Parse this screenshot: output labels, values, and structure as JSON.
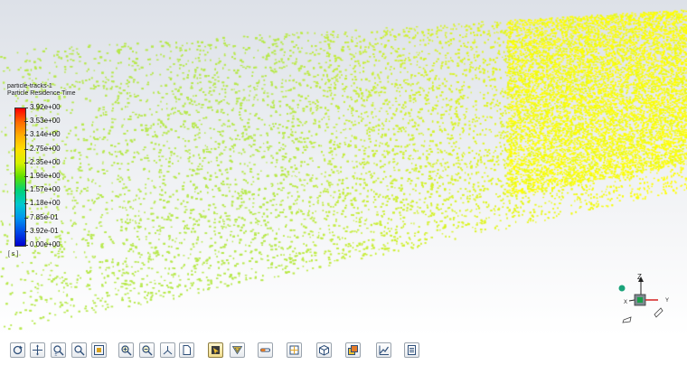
{
  "legend": {
    "name": "particle-tracks-1",
    "quantity": "Particle Residence Time",
    "unit": "[ s ]",
    "ticks": [
      "3.92e+00",
      "3.53e+00",
      "3.14e+00",
      "2.75e+00",
      "2.35e+00",
      "1.96e+00",
      "1.57e+00",
      "1.18e+00",
      "7.85e-01",
      "3.92e-01",
      "0.00e+00"
    ],
    "colors": [
      "#ff0000",
      "#ff6a00",
      "#ffb000",
      "#ffe000",
      "#d4f200",
      "#5ce000",
      "#00d27a",
      "#00c8d0",
      "#0094f0",
      "#0048e8",
      "#0000d0"
    ]
  },
  "triad": {
    "z_label": "Z",
    "y_label": "Y",
    "x_label": "X"
  },
  "scene": {
    "particle_color_near": "#b6e84a",
    "particle_color_far": "#ffff00"
  },
  "toolbar": {
    "buttons": [
      {
        "icon": "rotate-icon"
      },
      {
        "icon": "pan-icon"
      },
      {
        "icon": "zoom-icon"
      },
      {
        "icon": "zoom-region-icon"
      },
      {
        "icon": "fit-to-window-icon"
      },
      {
        "icon": "zoom-in-icon"
      },
      {
        "icon": "zoom-out-icon"
      },
      {
        "icon": "axes-view-icon"
      },
      {
        "icon": "document-icon"
      },
      {
        "icon": "select-probe-icon"
      },
      {
        "icon": "filter-icon"
      },
      {
        "icon": "clipping-icon"
      },
      {
        "icon": "mesh-icon"
      },
      {
        "icon": "cube-view-icon"
      },
      {
        "icon": "layers-icon"
      },
      {
        "icon": "chart-icon"
      },
      {
        "icon": "notes-icon"
      }
    ]
  }
}
